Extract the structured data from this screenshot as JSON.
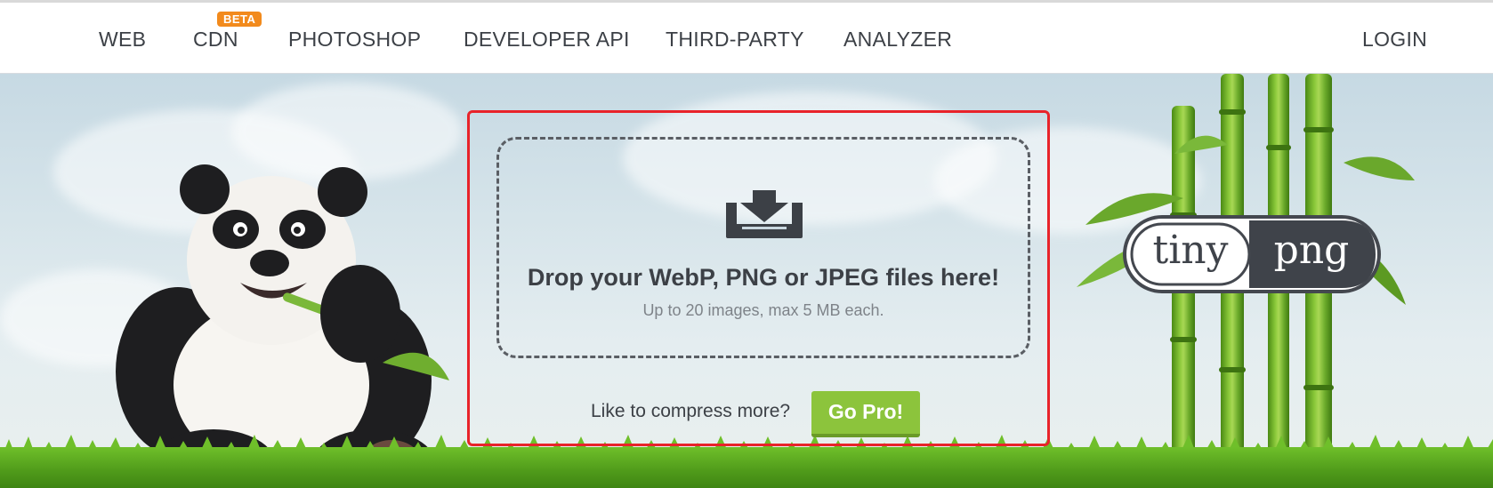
{
  "nav": {
    "items": [
      {
        "label": "WEB"
      },
      {
        "label": "CDN"
      },
      {
        "label": "PHOTOSHOP"
      },
      {
        "label": "DEVELOPER API"
      },
      {
        "label": "THIRD-PARTY"
      },
      {
        "label": "ANALYZER"
      }
    ],
    "cdn_badge": "BETA",
    "login": "LOGIN"
  },
  "dropzone": {
    "icon": "download-tray-icon",
    "title": "Drop your WebP, PNG or JPEG files here!",
    "subtitle": "Up to 20 images, max 5 MB each."
  },
  "promo": {
    "text": "Like to compress more?",
    "button": "Go Pro!"
  },
  "logo": {
    "left": "tiny",
    "right": "png"
  },
  "colors": {
    "accent_green": "#8cc43c",
    "beta_orange": "#f28a1c",
    "highlight_red": "#e8232a",
    "text_dark": "#3c4046"
  }
}
